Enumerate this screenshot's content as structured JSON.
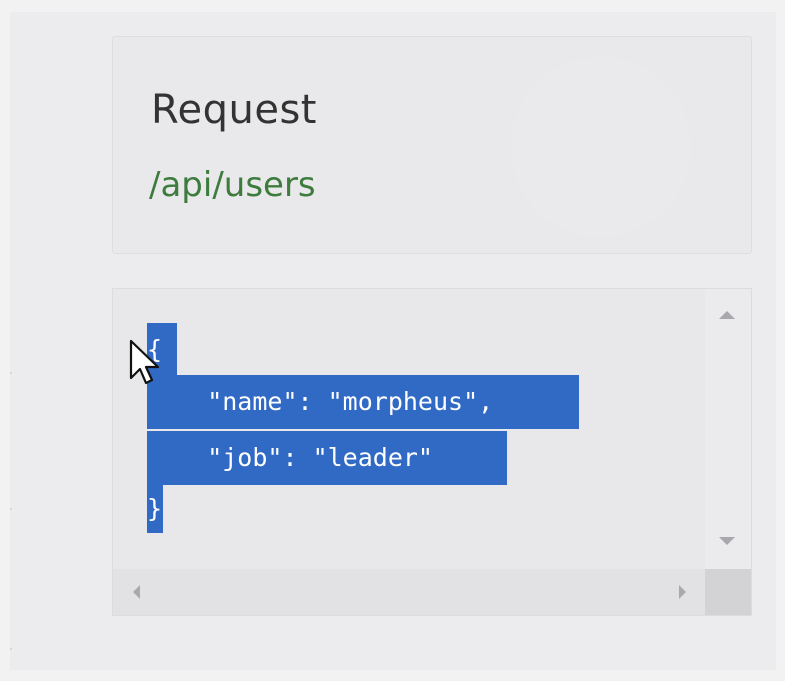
{
  "request": {
    "title": "Request",
    "url": "/api/users"
  },
  "code": {
    "lines": [
      "{",
      "    \"name\": \"morpheus\",",
      "    \"job\": \"leader\"",
      "}"
    ],
    "selected": true
  },
  "colors": {
    "url_green": "#3e7c3e",
    "selection_blue": "#316ac5",
    "background": "#ececee"
  },
  "icons": {
    "cursor": "mouse-pointer-icon",
    "scroll_up": "scroll-up-arrow-icon",
    "scroll_down": "scroll-down-arrow-icon",
    "scroll_left": "scroll-left-arrow-icon",
    "scroll_right": "scroll-right-arrow-icon"
  }
}
